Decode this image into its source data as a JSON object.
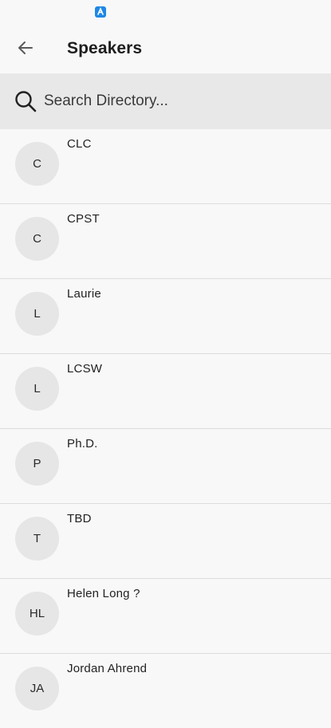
{
  "status_bar": {
    "app_icon": "app-notification-icon"
  },
  "header": {
    "back_icon": "arrow-left-icon",
    "title": "Speakers"
  },
  "search": {
    "icon": "search-icon",
    "placeholder": "Search Directory...",
    "value": ""
  },
  "speakers": [
    {
      "initials": "C",
      "name": "CLC"
    },
    {
      "initials": "C",
      "name": "CPST"
    },
    {
      "initials": "L",
      "name": "Laurie"
    },
    {
      "initials": "L",
      "name": "LCSW"
    },
    {
      "initials": "P",
      "name": "Ph.D."
    },
    {
      "initials": "T",
      "name": "TBD"
    },
    {
      "initials": "HL",
      "name": "Helen Long ?"
    },
    {
      "initials": "JA",
      "name": "Jordan Ahrend"
    }
  ]
}
